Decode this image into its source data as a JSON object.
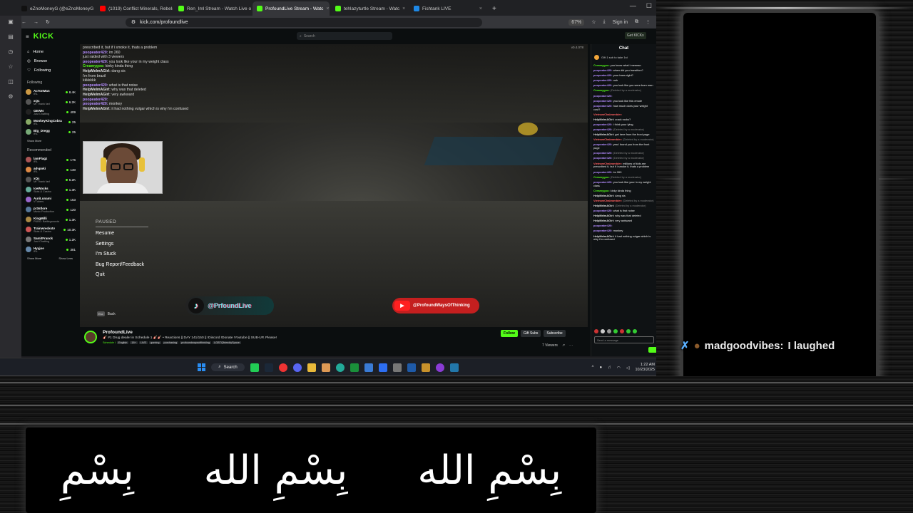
{
  "browser": {
    "tabs": [
      {
        "label": "eZnoMoneyG (@eZnoMoneyG",
        "color": "#111111",
        "active": false
      },
      {
        "label": "(1019) Conflict Minerals, Rebels",
        "color": "#ff0000",
        "active": false
      },
      {
        "label": "Ren_Iml Stream - Watch Live o",
        "color": "#53fc18",
        "active": false
      },
      {
        "label": "ProfoundLive Stream - Watc",
        "color": "#53fc18",
        "active": true
      },
      {
        "label": "tehlazyturtle Stream - Watc",
        "color": "#53fc18",
        "active": false
      },
      {
        "label": "Fishtank LIVE",
        "color": "#1e88e5",
        "active": false
      }
    ],
    "new_tab": "+",
    "url": "kick.com/profoundlive",
    "zoom": "67%",
    "signin": "Sign in"
  },
  "kick": {
    "logo": "KICK",
    "search_placeholder": "Search",
    "get_kicks": "Get KICKs",
    "nav": {
      "home": "Home",
      "browse": "Browse",
      "following": "Following"
    },
    "following_label": "Following",
    "following": [
      {
        "name": "AcTonMan",
        "cat": "IRL",
        "viewers": "8.4K",
        "color": "#c94"
      },
      {
        "name": "xQc",
        "cat": "Mr Thank fan!",
        "viewers": "6.2K",
        "color": "#555"
      },
      {
        "name": "GEWN",
        "cat": "Just Chatting",
        "viewers": "409",
        "color": "#222"
      },
      {
        "name": "MonkeyKingCobra",
        "cat": "IRL",
        "viewers": "25",
        "color": "#8a6"
      },
      {
        "name": "Big_Dregg",
        "cat": "IRL",
        "viewers": "25",
        "color": "#7a7"
      }
    ],
    "show_more": "Show More",
    "recommended_label": "Recommended",
    "recommended": [
      {
        "name": "lamFlagz",
        "cat": "IRL",
        "viewers": "176",
        "color": "#a55"
      },
      {
        "name": "advpoki",
        "cat": "IRL",
        "viewers": "130",
        "color": "#d84"
      },
      {
        "name": "xQc",
        "cat": "Mr Thank fan!",
        "viewers": "6.2K",
        "color": "#555"
      },
      {
        "name": "IceWocks",
        "cat": "Slots & Casino",
        "viewers": "1.3K",
        "color": "#6a9"
      },
      {
        "name": "AuriLunami",
        "cat": "VTubers",
        "viewers": "153",
        "color": "#96c"
      },
      {
        "name": "pr3stlore",
        "cat": "Music Production",
        "viewers": "120",
        "color": "#579"
      },
      {
        "name": "KingMilli",
        "cat": "PUBG: Battlegrounds",
        "viewers": "1.3K",
        "color": "#a84"
      },
      {
        "name": "Trainwreckstv",
        "cat": "Slots & Casino",
        "viewers": "10.3K",
        "color": "#c55"
      },
      {
        "name": "SamitFranck",
        "cat": "Just Chatting",
        "viewers": "1.2K",
        "color": "#777"
      },
      {
        "name": "Hyyjoe",
        "cat": "IRL",
        "viewers": "381",
        "color": "#68a"
      }
    ],
    "show_less": "Show Less",
    "video": {
      "bitrate": "v0.4.078",
      "overlay_chat": [
        {
          "u": "",
          "uc": "#cccccc",
          "t": "prescribed it, but if i smoke it, thats a problem"
        },
        {
          "u": "poopeater420:",
          "uc": "#b58cff",
          "t": "im 260"
        },
        {
          "u": "",
          "uc": "#ff4040",
          "t": "just raided with 3 viewers"
        },
        {
          "u": "poopeater420:",
          "uc": "#b58cff",
          "t": "you look like your in my weight class"
        },
        {
          "u": "Creamygoo:",
          "uc": "#53fc18",
          "t": "kinky kinda thing"
        },
        {
          "u": "HelpMeImAGirl:",
          "uc": "#e0e0e0",
          "t": "dang sis"
        },
        {
          "u": "",
          "uc": "#ff4040",
          "t": "i'm from brazil"
        },
        {
          "u": "",
          "uc": "#ff4040",
          "t": "kkkkkkk"
        },
        {
          "u": "poopeater420:",
          "uc": "#b58cff",
          "t": "what is that noise"
        },
        {
          "u": "HelpMeImAGirl:",
          "uc": "#e0e0e0",
          "t": "why was that deleted"
        },
        {
          "u": "HelpMeImAGirl:",
          "uc": "#e0e0e0",
          "t": "very awkward"
        },
        {
          "u": "poopeater420:",
          "uc": "#b58cff",
          "t": ""
        },
        {
          "u": "poopeater420:",
          "uc": "#b58cff",
          "t": "monkey"
        },
        {
          "u": "HelpMeImAGirl:",
          "uc": "#e0e0e0",
          "t": "it had nothing vulgar which is why i'm confused"
        }
      ],
      "pause_title": "PAUSED",
      "pause_items": [
        "Resume",
        "Settings",
        "I'm Stuck",
        "Bug Report/Feedback",
        "Quit"
      ],
      "esc_key": "Esc",
      "esc_label": "Back",
      "tiktok": "@PrfoundLive",
      "youtube": "@ProfoundWaysOfThinking"
    },
    "stream": {
      "name": "ProfoundLive",
      "title": "🎸 #1 Drug dealer in Schedule 1 🎸🎸 • Reactions || DAY 141/150 || !Discord !Donate !Youtube || SUB-UP, Please!",
      "category": "Schedule I",
      "tags": [
        "English",
        "18+",
        "LIVE",
        "gaming",
        "purchasing",
        "profoundwaysofthinking",
        "LGBTQfriendlySpace"
      ],
      "follow": "Follow",
      "gift_subs": "Gift Subs",
      "subscribe": "Subscribe",
      "viewers": "7 Viewers"
    },
    "chat": {
      "title": "Chat",
      "pinned": "Gift 1 sub to take 1st",
      "lines": [
        {
          "u": "Creamygoo:",
          "uc": "#53fc18",
          "t": "you know what i meeean"
        },
        {
          "u": "poopeater420:",
          "uc": "#b58cff",
          "t": "when did you transition?"
        },
        {
          "u": "poopeater420:",
          "uc": "#b58cff",
          "t": "your trans right?"
        },
        {
          "u": "poopeater420:",
          "uc": "#b58cff",
          "t": "ooh"
        },
        {
          "u": "poopeater420:",
          "uc": "#b58cff",
          "t": "you look like you were born man"
        },
        {
          "u": "Creamygoo:",
          "uc": "#53fc18",
          "t": "(Deleted by a moderator)",
          "del": true
        },
        {
          "u": "poopeater420:",
          "uc": "#b58cff",
          "t": ""
        },
        {
          "u": "poopeater420:",
          "uc": "#b58cff",
          "t": "you look like this emote"
        },
        {
          "u": "poopeater420:",
          "uc": "#b58cff",
          "t": "how much does your weight cost?"
        },
        {
          "u": "VietnamChakrambler:",
          "uc": "#ff6060",
          "t": ""
        },
        {
          "u": "HelpMeImAGirl:",
          "uc": "#e0e0e0",
          "t": "crack rocks?"
        },
        {
          "u": "poopeater420:",
          "uc": "#b58cff",
          "t": "i think your lying"
        },
        {
          "u": "poopeater420:",
          "uc": "#b58cff",
          "t": "(Deleted by a moderator)",
          "del": true
        },
        {
          "u": "HelpMeImAGirl:",
          "uc": "#e0e0e0",
          "t": "get here from the front page"
        },
        {
          "u": "VietnamChakrambler:",
          "uc": "#ff6060",
          "t": "(Deleted by a moderator)",
          "del": true
        },
        {
          "u": "poopeater420:",
          "uc": "#b58cff",
          "t": "yea i found you from the front page"
        },
        {
          "u": "poopeater420:",
          "uc": "#b58cff",
          "t": "(Deleted by a moderator)",
          "del": true
        },
        {
          "u": "poopeater420:",
          "uc": "#b58cff",
          "t": "(Deleted by a moderator)",
          "del": true
        },
        {
          "u": "VietnamChakrambler:",
          "uc": "#ff6060",
          "t": "millions of kids are prescribed it, but if i smoke it, thats a problem"
        },
        {
          "u": "poopeater420:",
          "uc": "#b58cff",
          "t": "im 260"
        },
        {
          "u": "Creamygoo:",
          "uc": "#53fc18",
          "t": "(Deleted by a moderator)",
          "del": true
        },
        {
          "u": "poopeater420:",
          "uc": "#b58cff",
          "t": "you look like your in my weight class"
        },
        {
          "u": "Creamygoo:",
          "uc": "#53fc18",
          "t": "kinky kinda thing"
        },
        {
          "u": "HelpMeImAGirl:",
          "uc": "#e0e0e0",
          "t": "dang sis"
        },
        {
          "u": "VietnamChakrambler:",
          "uc": "#ff6060",
          "t": "(Deleted by a moderator)",
          "del": true
        },
        {
          "u": "HelpMeImAGirl:",
          "uc": "#e0e0e0",
          "t": "(Deleted by a moderator)",
          "del": true
        },
        {
          "u": "poopeater420:",
          "uc": "#b58cff",
          "t": "what is that noise"
        },
        {
          "u": "HelpMeImAGirl:",
          "uc": "#e0e0e0",
          "t": "why was that deleted"
        },
        {
          "u": "HelpMeImAGirl:",
          "uc": "#e0e0e0",
          "t": "very awkward"
        },
        {
          "u": "poopeater420:",
          "uc": "#b58cff",
          "t": ""
        },
        {
          "u": "poopeater420:",
          "uc": "#b58cff",
          "t": "monkey"
        },
        {
          "u": "HelpMeImAGirl:",
          "uc": "#e0e0e0",
          "t": "it had nothing vulgar which is why i'm confused"
        }
      ],
      "input_placeholder": "Send a message"
    }
  },
  "taskbar": {
    "search": "Search",
    "time": "1:22 AM",
    "date": "10/23/2025"
  },
  "overlay": {
    "chat_user": "madgoodvibes:",
    "chat_text": "I laughed",
    "arabic": [
      "بِسْمِ الله",
      "بِسْمِ الله",
      "بِسْمِ"
    ]
  }
}
